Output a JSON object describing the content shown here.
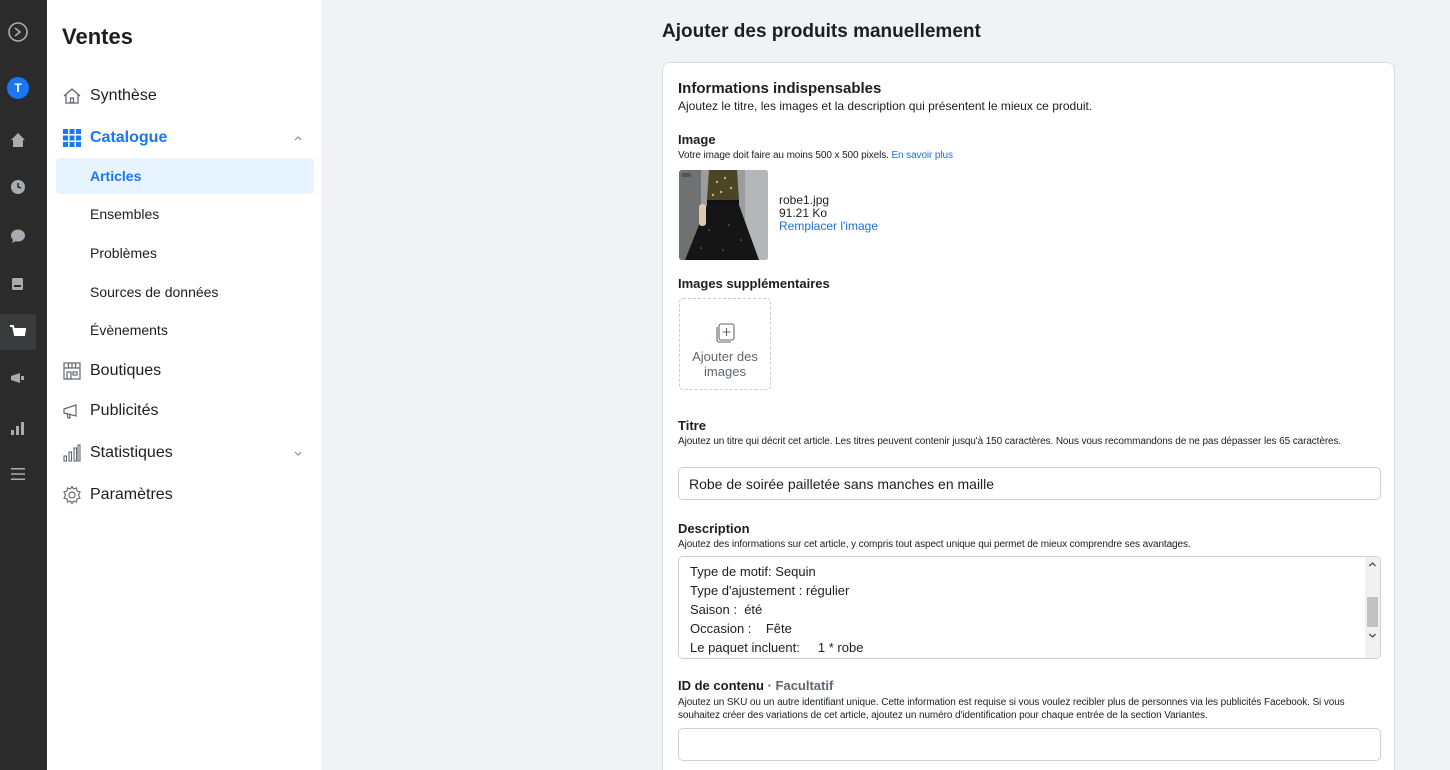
{
  "sidebar": {
    "title": "Ventes",
    "nav": {
      "synthese": "Synthèse",
      "catalogue": "Catalogue",
      "boutiques": "Boutiques",
      "publicites": "Publicités",
      "statistiques": "Statistiques",
      "parametres": "Paramètres"
    },
    "catalogue_items": [
      "Articles",
      "Ensembles",
      "Problèmes",
      "Sources de données",
      "Évènements"
    ]
  },
  "rail": {
    "avatar_letter": "T"
  },
  "main": {
    "page_title": "Ajouter des produits manuellement",
    "section_title": "Informations indispensables",
    "section_desc": "Ajoutez le titre, les images et la description qui présentent le mieux ce produit.",
    "image": {
      "label": "Image",
      "hint": "Votre image doit faire au moins 500 x 500 pixels.",
      "learn_more": "En savoir plus",
      "file_name": "robe1.jpg",
      "file_size": "91.21 Ko",
      "replace": "Remplacer l'image"
    },
    "extra_images": {
      "label": "Images supplémentaires",
      "add_line1": "Ajouter des",
      "add_line2": "images"
    },
    "title_field": {
      "label": "Titre",
      "hint": "Ajoutez un titre qui décrit cet article. Les titres peuvent contenir jusqu'à 150 caractères. Nous vous recommandons de ne pas dépasser les 65 caractères.",
      "value": "Robe de soirée pailletée sans manches en maille"
    },
    "description": {
      "label": "Description",
      "hint": "Ajoutez des informations sur cet article, y compris tout aspect unique qui permet de mieux comprendre ses avantages.",
      "lines": "Type de motif: Sequin\nType d'ajustement : régulier\nSaison :  été\nOccasion :    Fête\nLe paquet incluent:     1 * robe"
    },
    "content_id": {
      "label": "ID de contenu",
      "optional": "· Facultatif",
      "hint": "Ajoutez un SKU ou un autre identifiant unique. Cette information est requise si vous voulez recibler plus de personnes via les publicités Facebook. Si vous souhaitez créer des variations de cet article, ajoutez un numéro d'identification pour chaque entrée de la section Variantes.",
      "value": ""
    }
  }
}
